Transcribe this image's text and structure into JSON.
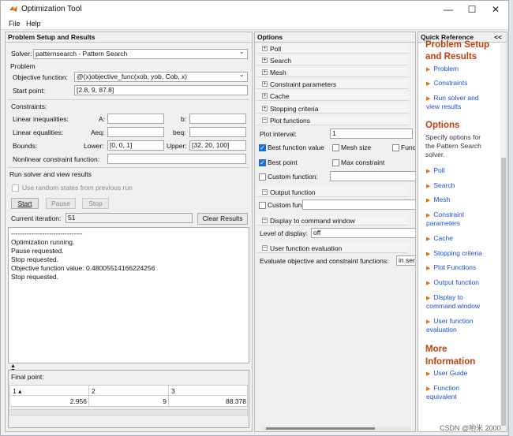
{
  "window": {
    "title": "Optimization Tool",
    "min": "—",
    "max": "☐",
    "close": "✕"
  },
  "menu": {
    "file": "File",
    "help": "Help"
  },
  "left": {
    "header": "Problem Setup and Results",
    "solver_label": "Solver:",
    "solver_value": "patternsearch - Pattern Search",
    "problem_label": "Problem",
    "objective_label": "Objective function:",
    "objective_value": "@(x)objective_func(xob, yob, Cob, x)",
    "start_label": "Start point:",
    "start_value": "[2.8, 9, 87.8]",
    "constraints_label": "Constraints:",
    "lin_ineq": "Linear inequalities:",
    "A": "A:",
    "b": "b:",
    "lin_eq": "Linear equalities:",
    "Aeq": "Aeq:",
    "beq": "beq:",
    "bounds": "Bounds:",
    "lower": "Lower:",
    "lower_value": "[0, 0, 1]",
    "upper": "Upper:",
    "upper_value": "[32, 20, 100]",
    "nonlin": "Nonlinear constraint function:",
    "run_label": "Run solver and view results",
    "random_states": "Use random states from previous run",
    "start_btn": "Start",
    "pause_btn": "Pause",
    "stop_btn": "Stop",
    "iteration_label": "Current iteration:",
    "iteration_value": "51",
    "clear_btn": "Clear Results",
    "output_lines": [
      "--------------------------------",
      "Optimization running.",
      "Pause requested.",
      "Stop requested.",
      "Objective function value: 0.48005514166224256",
      "Stop requested."
    ],
    "final_label": "Final point:",
    "final_cols": [
      "1 ▴",
      "2",
      "3"
    ],
    "final_vals": [
      "2.956",
      "9",
      "88.378"
    ]
  },
  "options": {
    "header": "Options",
    "poll": "Poll",
    "search": "Search",
    "mesh": "Mesh",
    "constraint_params": "Constraint parameters",
    "cache": "Cache",
    "stopping": "Stopping criteria",
    "plot_functions": "Plot functions",
    "plot_interval_label": "Plot interval:",
    "plot_interval_value": "1",
    "best_fval": "Best function value",
    "mesh_size": "Mesh size",
    "func_count": "Func",
    "best_point": "Best point",
    "max_constraint": "Max constraint",
    "custom_fn": "Custom function:",
    "output_function": "Output function",
    "display_cmd": "Display to command window",
    "level_label": "Level of display:",
    "level_value": "off",
    "user_eval": "User function evaluation",
    "eval_label": "Evaluate objective and constraint functions:",
    "eval_value": "in ser"
  },
  "quick": {
    "header": "Quick Reference",
    "collapse": "<<",
    "h1a": "Problem Setup",
    "h1b": "and Results",
    "l_problem": "Problem",
    "l_constraints": "Constraints",
    "l_run1": "Run solver and",
    "l_run2": "view results",
    "h2": "Options",
    "t1": "Specify options for",
    "t2": "the Pattern Search",
    "t3": "solver.",
    "l_poll": "Poll",
    "l_search": "Search",
    "l_mesh": "Mesh",
    "l_cp1": "Constraint",
    "l_cp2": "parameters",
    "l_cache": "Cache",
    "l_stop": "Stopping criteria",
    "l_plot": "Plot Functions",
    "l_output": "Output function",
    "l_disp1": "Display to",
    "l_disp2": "command window",
    "l_user1": "User function",
    "l_user2": "evaluation",
    "h3a": "More",
    "h3b": "Information",
    "l_guide": "User Guide",
    "l_fe1": "Function",
    "l_fe2": "equivalent"
  },
  "watermark": "CSDN @哟米 2000"
}
